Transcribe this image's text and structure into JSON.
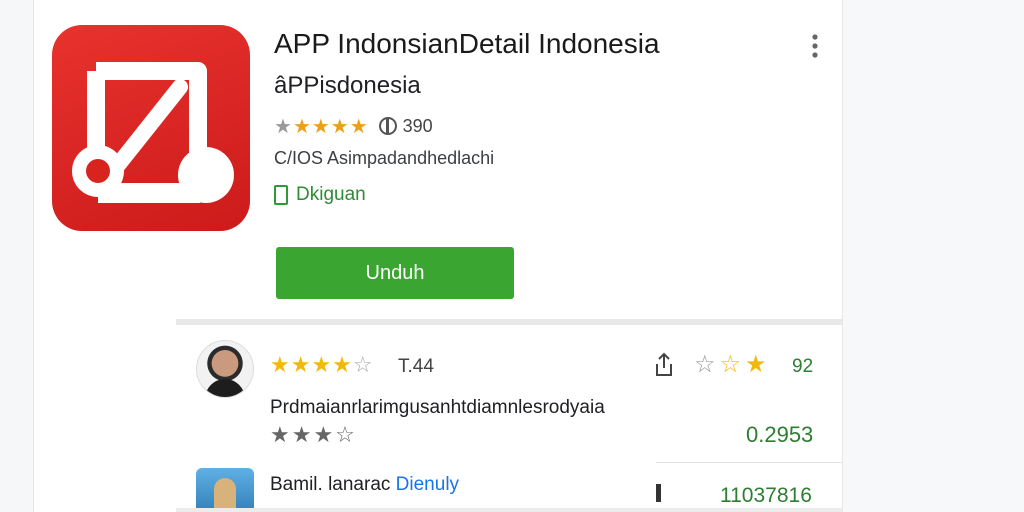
{
  "app": {
    "title": "APP  IndonsianDetail Indonesia",
    "subtitle": "âPPisdonesia",
    "rating_stars": 4.5,
    "rating_count": "390",
    "meta": "C/IOS Asimpadandhedlachi",
    "tag_label": "Dkiguan",
    "install_label": "Unduh",
    "icon_name": "app-logo-icon",
    "brand_color": "#d9231f",
    "button_color": "#3aa631"
  },
  "reviews": [
    {
      "avatar": "user-photo",
      "stars": 4,
      "score": "T.44",
      "side_stars": 2.5,
      "count": "92",
      "text": "Prdmaianrlarimgusanhtdiamnlesrodyaia",
      "gray_stars": 3.5,
      "value": "0.2953"
    },
    {
      "avatar": "landscape-photo",
      "name": "Bamil. lanarac",
      "name_link": "Dienuly",
      "count": "11037816"
    }
  ]
}
